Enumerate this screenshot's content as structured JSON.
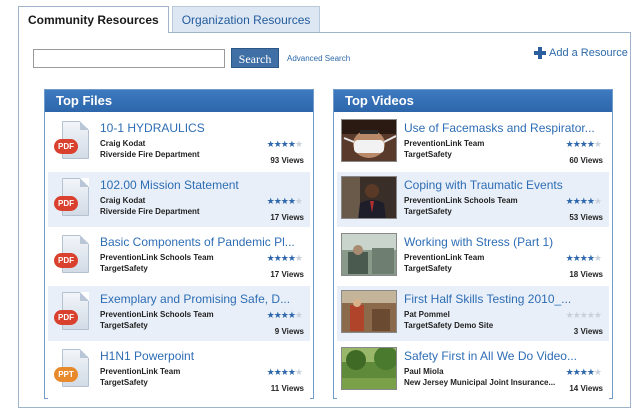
{
  "tabs": [
    {
      "label": "Community Resources",
      "active": true
    },
    {
      "label": "Organization Resources",
      "active": false
    }
  ],
  "search": {
    "value": "",
    "button_label": "Search",
    "advanced_label": "Advanced Search"
  },
  "add_resource_label": "Add a Resource",
  "top_files": {
    "heading": "Top Files",
    "items": [
      {
        "title": "10-1 HYDRAULICS",
        "author": "Craig Kodat",
        "org": "Riverside Fire Department",
        "rating": 4,
        "views": "93 Views",
        "type": "PDF"
      },
      {
        "title": "102.00 Mission Statement",
        "author": "Craig Kodat",
        "org": "Riverside Fire Department",
        "rating": 4,
        "views": "17 Views",
        "type": "PDF"
      },
      {
        "title": "Basic Components of Pandemic Pl...",
        "author": "PreventionLink Schools Team",
        "org": "TargetSafety",
        "rating": 4,
        "views": "17 Views",
        "type": "PDF"
      },
      {
        "title": "Exemplary and Promising Safe, D...",
        "author": "PreventionLink Schools Team",
        "org": "TargetSafety",
        "rating": 4,
        "views": "9 Views",
        "type": "PDF"
      },
      {
        "title": "H1N1 Powerpoint",
        "author": "PreventionLink Team",
        "org": "TargetSafety",
        "rating": 4,
        "views": "11 Views",
        "type": "PPT"
      }
    ]
  },
  "top_videos": {
    "heading": "Top Videos",
    "items": [
      {
        "title": "Use of Facemasks and Respirator...",
        "author": "PreventionLink Team",
        "org": "TargetSafety",
        "rating": 4,
        "views": "60 Views"
      },
      {
        "title": "Coping with Traumatic Events",
        "author": "PreventionLink Schools Team",
        "org": "TargetSafety",
        "rating": 4,
        "views": "53 Views"
      },
      {
        "title": "Working with Stress (Part 1)",
        "author": "PreventionLink Team",
        "org": "TargetSafety",
        "rating": 4,
        "views": "18 Views"
      },
      {
        "title": "First Half Skills Testing 2010_...",
        "author": "Pat Pommel",
        "org": "TargetSafety Demo Site",
        "rating": 0,
        "views": "3 Views"
      },
      {
        "title": "Safety First in All We Do Video...",
        "author": "Paul Miola",
        "org": "New Jersey Municipal Joint Insurance...",
        "rating": 4,
        "views": "14 Views"
      }
    ]
  },
  "colors": {
    "accent": "#2d66ab",
    "link": "#2e6db4",
    "pdf_badge": "#d9402e",
    "ppt_badge": "#e8892c",
    "alt_row": "#e8eff8"
  }
}
